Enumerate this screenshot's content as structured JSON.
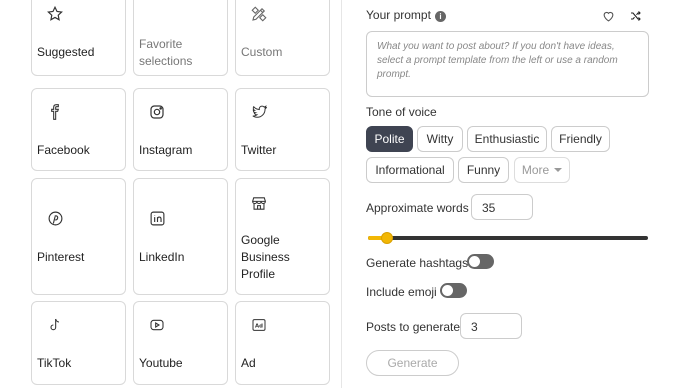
{
  "templates": [
    {
      "label": "Suggested",
      "icon": "star-icon"
    },
    {
      "label": "Favorite selections",
      "icon": "heart-icon"
    },
    {
      "label": "Custom",
      "icon": "pencil-ruler-icon"
    },
    {
      "label": "Facebook",
      "icon": "facebook-icon"
    },
    {
      "label": "Instagram",
      "icon": "instagram-icon"
    },
    {
      "label": "Twitter",
      "icon": "twitter-icon"
    },
    {
      "label": "Pinterest",
      "icon": "pinterest-icon"
    },
    {
      "label": "LinkedIn",
      "icon": "linkedin-icon"
    },
    {
      "label": "Google Business Profile",
      "icon": "storefront-icon"
    },
    {
      "label": "TikTok",
      "icon": "tiktok-icon"
    },
    {
      "label": "Youtube",
      "icon": "youtube-icon"
    },
    {
      "label": "Ad",
      "icon": "ad-icon"
    }
  ],
  "prompt": {
    "label": "Your prompt",
    "info_icon": "i",
    "placeholder": "What you want to post about? If you don't have ideas, select a prompt template from the left or use a random prompt."
  },
  "tone": {
    "label": "Tone of voice",
    "options": [
      "Polite",
      "Witty",
      "Enthusiastic",
      "Friendly",
      "Informational",
      "Funny"
    ],
    "selected": "Polite",
    "more_label": "More"
  },
  "words": {
    "label": "Approximate words",
    "value": "35",
    "slider_fraction": 0.05
  },
  "hashtags": {
    "label": "Generate hashtags",
    "enabled": false
  },
  "emoji": {
    "label": "Include emoji",
    "enabled": false
  },
  "posts": {
    "label": "Posts to generate",
    "value": "3"
  },
  "generate_label": "Generate",
  "colors": {
    "accent": "#f2b705",
    "selected_chip": "#3f4452",
    "toggle_off": "#666666"
  }
}
